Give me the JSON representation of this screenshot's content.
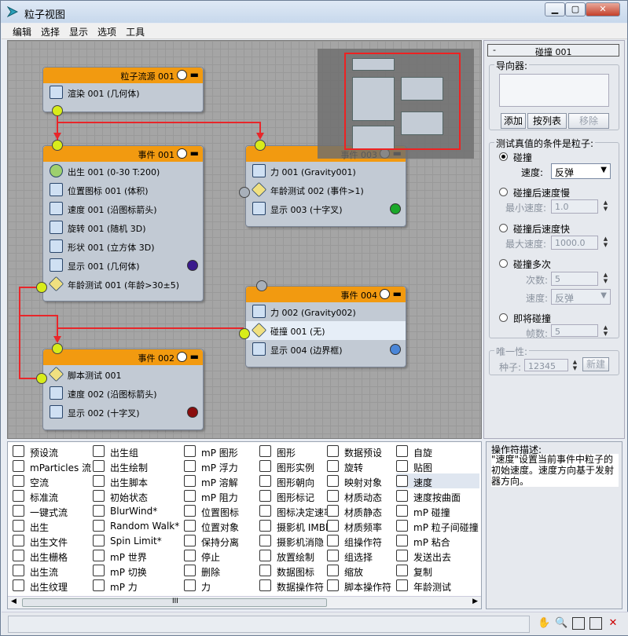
{
  "window": {
    "title": "粒子视图",
    "buttons": {
      "minimize": "▁",
      "maximize": "▢",
      "close": "✕"
    }
  },
  "menu": [
    "编辑",
    "选择",
    "显示",
    "选项",
    "工具"
  ],
  "colors": {
    "event_header": "#f29a10",
    "wire": "#e8262a",
    "pin": "#d8ec1a"
  },
  "nodes": {
    "source": {
      "title": "粒子流源 001",
      "ops": [
        {
          "label": "渲染 001 (几何体)",
          "icon": "teapot-icon"
        }
      ]
    },
    "event001": {
      "title": "事件 001",
      "ops": [
        {
          "label": "出生 001 (0-30 T:200)",
          "icon": "birth-icon"
        },
        {
          "label": "位置图标 001 (体积)",
          "icon": "position-icon"
        },
        {
          "label": "速度 001 (沿图标箭头)",
          "icon": "speed-icon"
        },
        {
          "label": "旋转 001 (随机 3D)",
          "icon": "rotation-icon"
        },
        {
          "label": "形状 001 (立方体 3D)",
          "icon": "shape-icon"
        },
        {
          "label": "显示 001 (几何体)",
          "icon": "display-icon",
          "color": "#3a1a8c"
        },
        {
          "label": "年龄测试 001 (年龄>30±5)",
          "icon": "age-test-icon"
        }
      ]
    },
    "event003": {
      "title": "事件 003",
      "ops": [
        {
          "label": "力 001 (Gravity001)",
          "icon": "force-icon"
        },
        {
          "label": "年龄测试 002 (事件>1)",
          "icon": "age-test-icon"
        },
        {
          "label": "显示 003 (十字叉)",
          "icon": "display-icon",
          "color": "#1aa82a"
        }
      ]
    },
    "event004": {
      "title": "事件 004",
      "ops": [
        {
          "label": "力 002 (Gravity002)",
          "icon": "force-icon"
        },
        {
          "label": "碰撞 001 (无)",
          "icon": "collision-icon"
        },
        {
          "label": "显示 004 (边界框)",
          "icon": "display-icon",
          "color": "#4a86d8"
        }
      ]
    },
    "event002": {
      "title": "事件 002",
      "ops": [
        {
          "label": "脚本测试 001",
          "icon": "script-test-icon"
        },
        {
          "label": "速度 002 (沿图标箭头)",
          "icon": "speed-icon"
        },
        {
          "label": "显示 002 (十字叉)",
          "icon": "display-icon",
          "color": "#8a0d0d"
        }
      ]
    }
  },
  "panel": {
    "rollout_title": "碰撞 001",
    "rollout_minus": "-",
    "deflectors_label": "导向器:",
    "btn_add": "添加",
    "btn_list": "按列表",
    "btn_remove": "移除",
    "test_group_label": "测试真值的条件是粒子:",
    "opt_collide": "碰撞",
    "speed_label": "速度:",
    "speed_value": "反弹",
    "opt_slow": "碰撞后速度慢",
    "min_speed_label": "最小速度:",
    "min_speed_value": "1.0",
    "opt_fast": "碰撞后速度快",
    "max_speed_label": "最大速度:",
    "max_speed_value": "1000.0",
    "opt_multi": "碰撞多次",
    "times_label": "次数:",
    "times_value": "5",
    "multi_speed_label": "速度:",
    "multi_speed_value": "反弹",
    "opt_will": "即将碰撞",
    "frames_label": "帧数:",
    "frames_value": "5",
    "unique_label": "唯一性:",
    "seed_label": "种子:",
    "seed_value": "12345",
    "btn_new": "新建"
  },
  "depot": [
    {
      "label": "预设流",
      "icon": "preset-flow-icon"
    },
    {
      "label": "mParticles 流",
      "icon": "mparticles-flow-icon"
    },
    {
      "label": "空流",
      "icon": "empty-flow-icon"
    },
    {
      "label": "标准流",
      "icon": "standard-flow-icon"
    },
    {
      "label": "一键式流",
      "icon": "one-click-flow-icon"
    },
    {
      "label": "出生",
      "icon": "birth-icon"
    },
    {
      "label": "出生文件",
      "icon": "birth-file-icon"
    },
    {
      "label": "出生栅格",
      "icon": "birth-grid-icon"
    },
    {
      "label": "出生流",
      "icon": "birth-stream-icon"
    },
    {
      "label": "出生纹理",
      "icon": "birth-texture-icon"
    },
    {
      "label": "出生组",
      "icon": "birth-group-icon"
    },
    {
      "label": "出生绘制",
      "icon": "birth-paint-icon"
    },
    {
      "label": "出生脚本",
      "icon": "birth-script-icon"
    },
    {
      "label": "初始状态",
      "icon": "initial-state-icon"
    },
    {
      "label": "BlurWind*",
      "icon": "blurwind-icon"
    },
    {
      "label": "Random Walk*",
      "icon": "random-walk-icon"
    },
    {
      "label": "Spin Limit*",
      "icon": "spin-limit-icon"
    },
    {
      "label": "mP 世界",
      "icon": "mp-world-icon"
    },
    {
      "label": "mP 切换",
      "icon": "mp-switch-icon"
    },
    {
      "label": "mP 力",
      "icon": "mp-force-icon"
    },
    {
      "label": "mP 图形",
      "icon": "mp-shape-icon"
    },
    {
      "label": "mP 浮力",
      "icon": "mp-buoyancy-icon"
    },
    {
      "label": "mP 溶解",
      "icon": "mp-solvent-icon"
    },
    {
      "label": "mP 阻力",
      "icon": "mp-drag-icon"
    },
    {
      "label": "位置图标",
      "icon": "position-icon"
    },
    {
      "label": "位置对象",
      "icon": "position-object-icon"
    },
    {
      "label": "保持分离",
      "icon": "keep-apart-icon"
    },
    {
      "label": "停止",
      "icon": "stop-icon"
    },
    {
      "label": "删除",
      "icon": "delete-icon"
    },
    {
      "label": "力",
      "icon": "force-icon"
    },
    {
      "label": "图形",
      "icon": "shape-icon"
    },
    {
      "label": "图形实例",
      "icon": "shape-instance-icon"
    },
    {
      "label": "图形朝向",
      "icon": "shape-facing-icon"
    },
    {
      "label": "图形标记",
      "icon": "shape-mark-icon"
    },
    {
      "label": "图标决定速率",
      "icon": "speed-by-icon-icon"
    },
    {
      "label": "摄影机 IMBlur",
      "icon": "camera-imblur-icon"
    },
    {
      "label": "摄影机消隐",
      "icon": "camera-culling-icon"
    },
    {
      "label": "放置绘制",
      "icon": "placement-paint-icon"
    },
    {
      "label": "数据图标",
      "icon": "data-icon-icon"
    },
    {
      "label": "数据操作符",
      "icon": "data-operator-icon"
    },
    {
      "label": "数据预设",
      "icon": "data-preset-icon"
    },
    {
      "label": "旋转",
      "icon": "rotation-icon"
    },
    {
      "label": "映射对象",
      "icon": "mapping-object-icon"
    },
    {
      "label": "材质动态",
      "icon": "material-dynamic-icon"
    },
    {
      "label": "材质静态",
      "icon": "material-static-icon"
    },
    {
      "label": "材质频率",
      "icon": "material-frequency-icon"
    },
    {
      "label": "组操作符",
      "icon": "group-operator-icon"
    },
    {
      "label": "组选择",
      "icon": "group-select-icon"
    },
    {
      "label": "缩放",
      "icon": "scale-icon"
    },
    {
      "label": "脚本操作符",
      "icon": "script-operator-icon"
    },
    {
      "label": "自旋",
      "icon": "spin-icon"
    },
    {
      "label": "贴图",
      "icon": "mapping-icon"
    },
    {
      "label": "速度",
      "icon": "speed-icon"
    },
    {
      "label": "速度按曲面",
      "icon": "speed-by-surface-icon"
    },
    {
      "label": "mP 碰撞",
      "icon": "mp-collision-icon"
    },
    {
      "label": "mP 粒子间碰撞",
      "icon": "mp-inter-collision-icon"
    },
    {
      "label": "mP 粘合",
      "icon": "mp-glue-icon"
    },
    {
      "label": "发送出去",
      "icon": "send-out-icon"
    },
    {
      "label": "复制",
      "icon": "spawn-icon"
    },
    {
      "label": "年龄测试",
      "icon": "age-test-icon"
    }
  ],
  "description": {
    "title": "操作符描述:",
    "text": "\"速度\"设置当前事件中粒子的初始速度。速度方向基于发射器方向。"
  },
  "depot_scroll": {
    "grip": "III",
    "left": "◀",
    "right": "▶"
  },
  "status_icons": [
    "pan-icon",
    "zoom-icon",
    "zoom-region-icon",
    "zoom-extents-icon",
    "no-zoom-icon"
  ]
}
